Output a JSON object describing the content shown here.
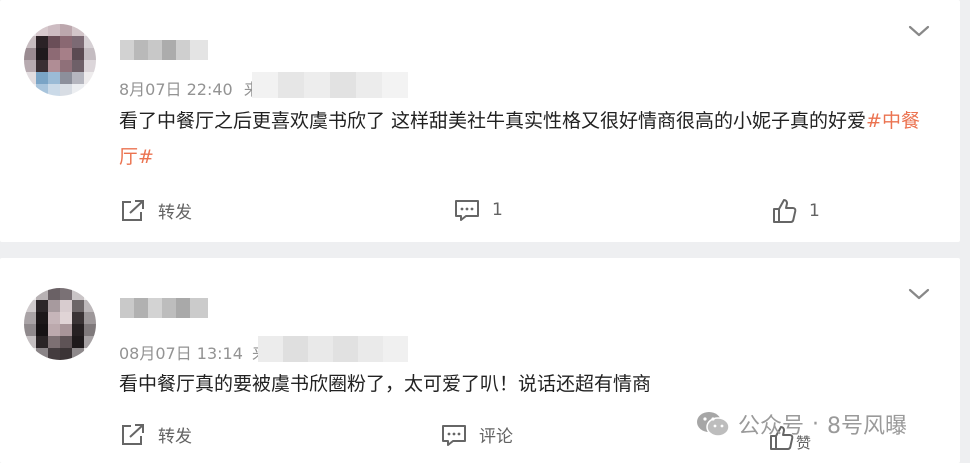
{
  "comments": [
    {
      "time": "8月07日 22:40",
      "location_prefix": "来",
      "text": "看了中餐厅之后更喜欢虞书欣了 这样甜美社牛真实性格又很好情商很高的小妮子真的好爱",
      "hashtag": "#中餐厅#",
      "actions": {
        "repost": "转发",
        "comment": "1",
        "like": "1"
      }
    },
    {
      "time": "08月07日 13:14",
      "location_prefix": "来",
      "text": "看中餐厅真的要被虞书欣圈粉了，太可爱了叭！说话还超有情商",
      "hashtag": "",
      "actions": {
        "repost": "转发",
        "comment": "评论",
        "like": "赞"
      }
    }
  ],
  "watermark": {
    "channel": "公众号",
    "separator": "·",
    "account": "8号风曝"
  },
  "icons": [
    "chevron-down-icon",
    "repost-icon",
    "comment-icon",
    "like-icon",
    "wechat-icon"
  ],
  "colors": {
    "hashtag": "#eb7350",
    "meta": "#939393",
    "background": "#eeeff1"
  }
}
